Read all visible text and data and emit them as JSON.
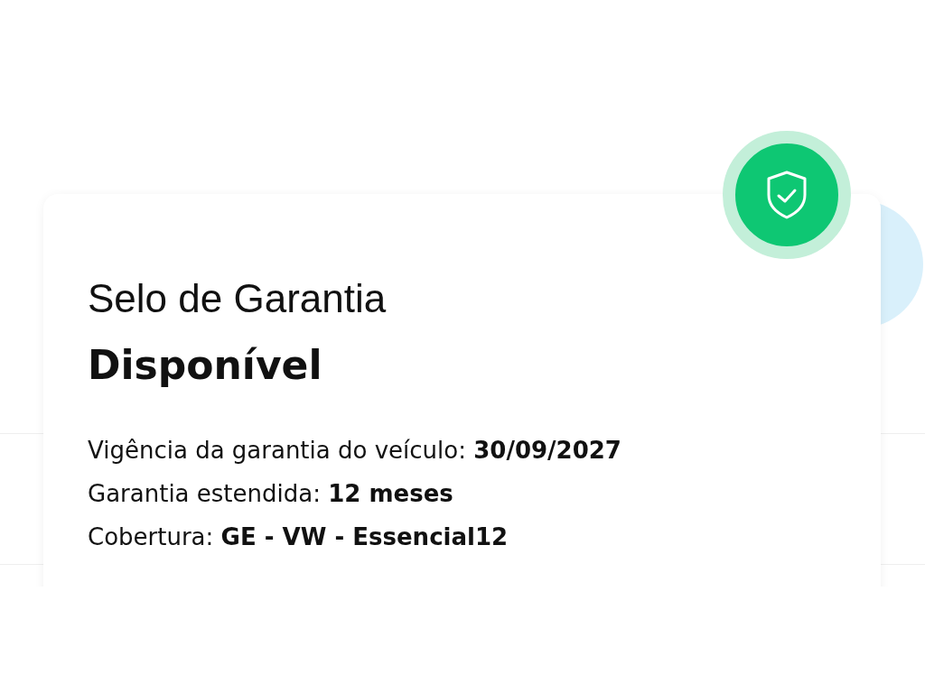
{
  "card": {
    "title": "Selo de Garantia",
    "status": "Disponível",
    "details": [
      "Vigência da garantia do veículo: **30/09/2027**",
      "Garantia estendida: **12 meses**",
      "Cobertura: **GE - VW - Essencial12**"
    ]
  }
}
